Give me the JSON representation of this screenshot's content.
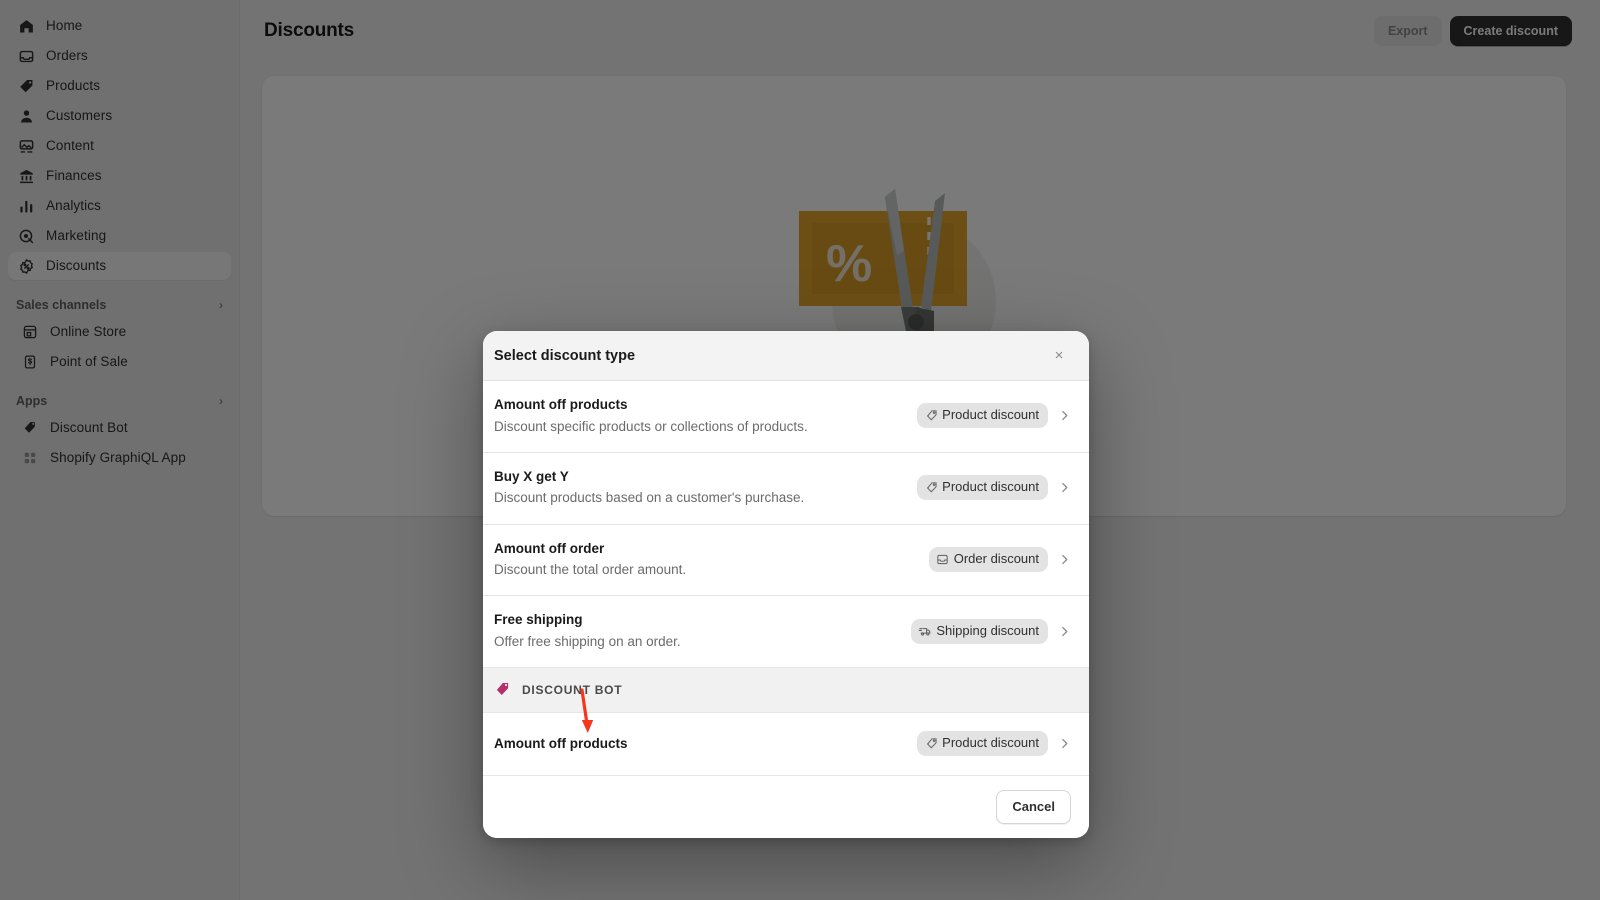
{
  "sidebar": {
    "nav": [
      {
        "label": "Home",
        "icon": "home-icon"
      },
      {
        "label": "Orders",
        "icon": "orders-icon"
      },
      {
        "label": "Products",
        "icon": "products-tag-icon"
      },
      {
        "label": "Customers",
        "icon": "customers-person-icon"
      },
      {
        "label": "Content",
        "icon": "content-image-icon"
      },
      {
        "label": "Finances",
        "icon": "finances-bank-icon"
      },
      {
        "label": "Analytics",
        "icon": "analytics-bars-icon"
      },
      {
        "label": "Marketing",
        "icon": "marketing-target-icon"
      },
      {
        "label": "Discounts",
        "icon": "discounts-badge-icon",
        "active": true
      }
    ],
    "sections": [
      {
        "title": "Sales channels",
        "items": [
          {
            "label": "Online Store",
            "icon": "store-icon"
          },
          {
            "label": "Point of Sale",
            "icon": "point-of-sale-icon"
          }
        ]
      },
      {
        "title": "Apps",
        "items": [
          {
            "label": "Discount Bot",
            "icon": "discount-bot-tag-icon"
          },
          {
            "label": "Shopify GraphiQL App",
            "icon": "graphiql-app-icon"
          }
        ]
      }
    ]
  },
  "topbar": {
    "title": "Discounts",
    "export_label": "Export",
    "create_label": "Create discount"
  },
  "empty_state": {
    "illustration": "coupon-and-scissors-illustration"
  },
  "modal": {
    "title": "Select discount type",
    "close_label": "×",
    "cancel_label": "Cancel",
    "options": [
      {
        "title": "Amount off products",
        "description": "Discount specific products or collections of products.",
        "badge": "Product discount",
        "badge_icon": "tag-icon"
      },
      {
        "title": "Buy X get Y",
        "description": "Discount products based on a customer's purchase.",
        "badge": "Product discount",
        "badge_icon": "tag-icon"
      },
      {
        "title": "Amount off order",
        "description": "Discount the total order amount.",
        "badge": "Order discount",
        "badge_icon": "inbox-icon"
      },
      {
        "title": "Free shipping",
        "description": "Offer free shipping on an order.",
        "badge": "Shipping discount",
        "badge_icon": "delivery-truck-icon"
      }
    ],
    "app_section": {
      "label": "DISCOUNT BOT",
      "icon": "discount-bot-tag-icon",
      "option": {
        "title": "Amount off products",
        "badge": "Product discount",
        "badge_icon": "tag-icon"
      }
    }
  },
  "annotation": {
    "arrow_color": "#f4361c",
    "points_to": "Amount off products"
  },
  "colors": {
    "primary_button": "#303030",
    "app_icon": "#b5306a",
    "backdrop": "rgba(0,0,0,0.52)"
  }
}
